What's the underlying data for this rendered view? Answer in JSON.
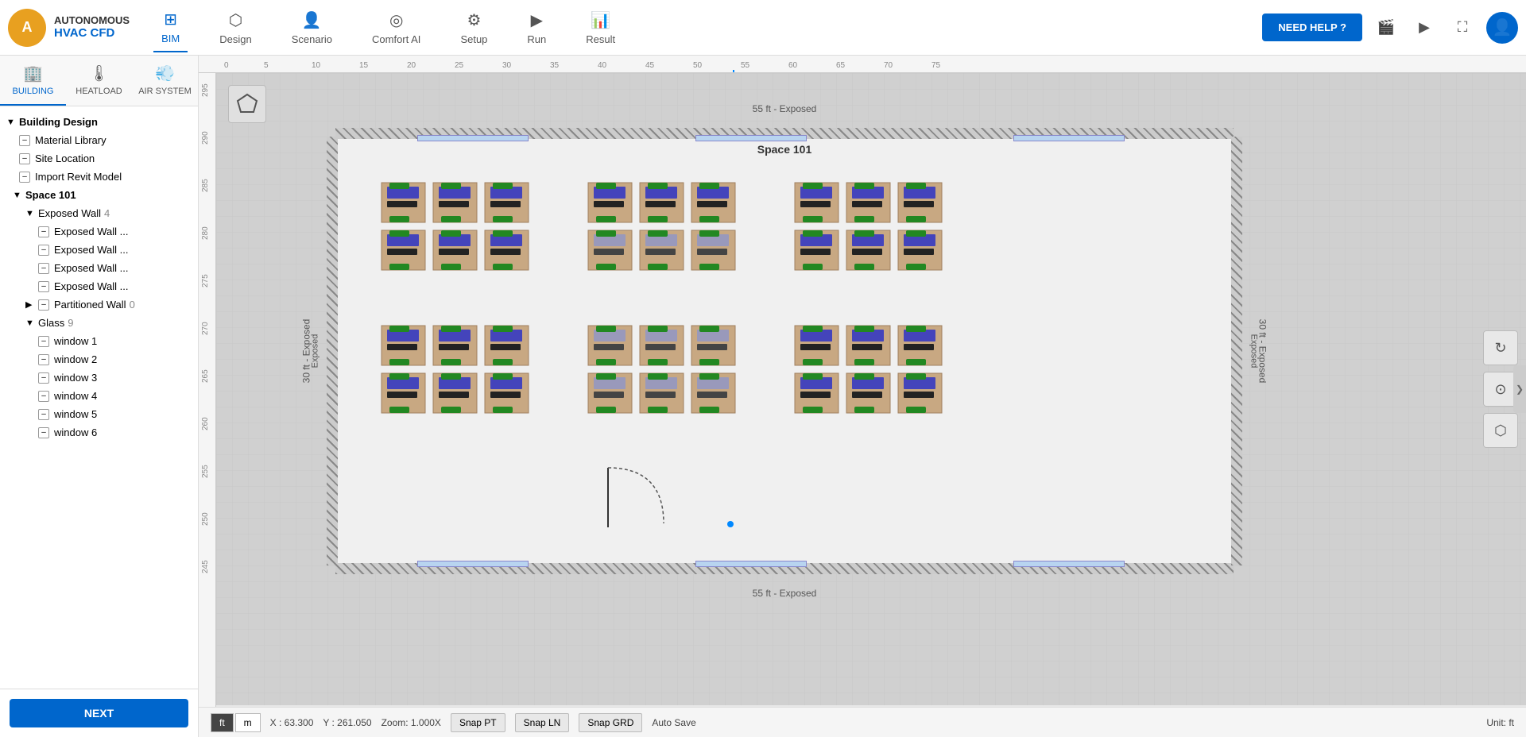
{
  "app": {
    "title": "Autonomous HVAC CFD",
    "logo_letters": "A"
  },
  "nav": {
    "items": [
      {
        "id": "bim",
        "label": "BIM",
        "icon": "⊞",
        "active": true
      },
      {
        "id": "design",
        "label": "Design",
        "icon": "⬡"
      },
      {
        "id": "scenario",
        "label": "Scenario",
        "icon": "👤"
      },
      {
        "id": "comfort-ai",
        "label": "Comfort AI",
        "icon": "◎"
      },
      {
        "id": "setup",
        "label": "Setup",
        "icon": "⚙"
      },
      {
        "id": "run",
        "label": "Run",
        "icon": "▶"
      },
      {
        "id": "result",
        "label": "Result",
        "icon": "📊"
      }
    ],
    "need_help": "NEED HELP ?",
    "camera_icon": "🎬",
    "video_icon": "▶",
    "expand_icon": "⛶"
  },
  "sidebar": {
    "tabs": [
      {
        "id": "building",
        "label": "BUILDING",
        "icon": "🏢",
        "active": true
      },
      {
        "id": "heatload",
        "label": "HEATLOAD",
        "icon": "🌡"
      },
      {
        "id": "air-system",
        "label": "AIR SYSTEM",
        "icon": "💨"
      }
    ],
    "tree": {
      "building_design": "Building Design",
      "material_library": "Material Library",
      "site_location": "Site Location",
      "import_revit": "Import Revit Model",
      "space_101": "Space 101",
      "exposed_wall": "Exposed Wall",
      "exposed_wall_count": "4",
      "exposed_wall_1": "Exposed Wall ...",
      "exposed_wall_2": "Exposed Wall ...",
      "exposed_wall_3": "Exposed Wall ...",
      "exposed_wall_4": "Exposed Wall ...",
      "partitioned_wall": "Partitioned Wall",
      "partitioned_wall_count": "0",
      "glass": "Glass",
      "glass_count": "9",
      "window_1": "window 1",
      "window_2": "window 2",
      "window_3": "window 3",
      "window_4": "window 4",
      "window_5": "window 5",
      "window_6": "window 6"
    },
    "next_btn": "NEXT"
  },
  "canvas": {
    "room_label": "Space 101",
    "dim_top": "55 ft - Exposed",
    "dim_bottom": "55 ft - Exposed",
    "dim_left": "30 ft - Exposed",
    "dim_right": "30 ft - Exposed",
    "toolbar_icon": "⬡",
    "right_tools": [
      "↻",
      "⊙",
      "⬡"
    ],
    "right_panel_arrow": "❯"
  },
  "statusbar": {
    "x_label": "X : 63.300",
    "y_label": "Y : 261.050",
    "zoom_label": "Zoom: 1.000X",
    "snap_pt": "Snap PT",
    "snap_ln": "Snap LN",
    "snap_grd": "Snap GRD",
    "auto_save": "Auto Save",
    "unit": "Unit: ft",
    "unit_ft": "ft",
    "unit_m": "m"
  }
}
